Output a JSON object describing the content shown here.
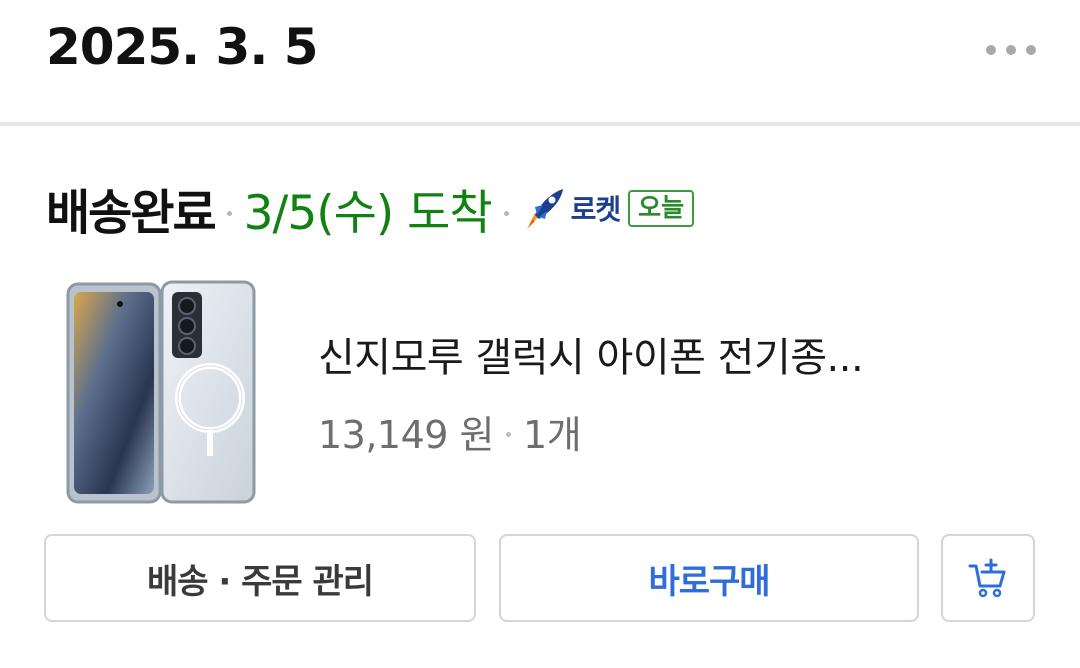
{
  "header": {
    "date": "2025. 3. 5",
    "more_icon": "more-dots-icon"
  },
  "order": {
    "status": "배송완료",
    "arrival": "3/5(수) 도착",
    "arrival_color": "#118211",
    "badge": {
      "icon": "rocket-icon",
      "label": "로켓",
      "tag": "오늘"
    }
  },
  "product": {
    "name": "신지모루 갤럭시 아이폰 전기종...",
    "price": "13,149 원",
    "quantity": "1개",
    "image": "phone-case-thumbnail"
  },
  "actions": {
    "manage_label": "배송 · 주문 관리",
    "buy_label": "바로구매",
    "buy_color": "#2f6ed8",
    "cart_icon": "add-to-cart-icon"
  }
}
